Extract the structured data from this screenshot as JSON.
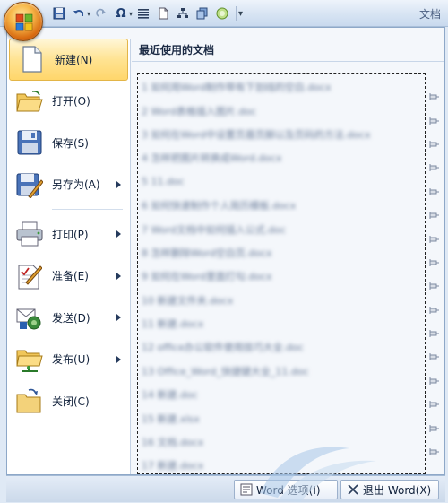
{
  "window": {
    "title": "文档"
  },
  "quick_access": {
    "icons": [
      "save-icon",
      "undo-icon",
      "redo-icon",
      "symbol-omega-icon",
      "align-icon",
      "new-doc-icon",
      "org-chart-icon",
      "copy-icon",
      "circle-icon",
      "customize-dropdown-icon"
    ],
    "omega": "Ω"
  },
  "menu": {
    "items": [
      {
        "label": "新建(N)",
        "icon": "new-document-icon",
        "has_submenu": false,
        "active": true
      },
      {
        "label": "打开(O)",
        "icon": "open-folder-icon",
        "has_submenu": false
      },
      {
        "label": "保存(S)",
        "icon": "save-disk-icon",
        "has_submenu": false
      },
      {
        "label": "另存为(A)",
        "icon": "save-as-icon",
        "has_submenu": true
      },
      {
        "label": "打印(P)",
        "icon": "printer-icon",
        "has_submenu": true
      },
      {
        "label": "准备(E)",
        "icon": "prepare-icon",
        "has_submenu": true
      },
      {
        "label": "发送(D)",
        "icon": "send-icon",
        "has_submenu": true
      },
      {
        "label": "发布(U)",
        "icon": "publish-icon",
        "has_submenu": true
      },
      {
        "label": "关闭(C)",
        "icon": "close-folder-icon",
        "has_submenu": false
      }
    ]
  },
  "recent": {
    "title": "最近使用的文档",
    "files": [
      "1 如何用Word制作带有下划线的空白.docx",
      "2 Word表格插入图片.doc",
      "3 如何在Word中设置页眉页脚以及页码的方法.docx",
      "4 怎样把图片转换成Word.docx",
      "5 11.doc",
      "6 如何快速制作个人简历模板.docx",
      "7 Word文档中如何插入公式.doc",
      "8 怎样删除Word空白页.docx",
      "9 如何在Word里面打勾.docx",
      "10 新建文件夹.docx",
      "11 新建.docx",
      "12 office办公软件使用技巧大全.doc",
      "13 Office_Word_快捷键大全_11.doc",
      "14 新建.doc",
      "15 新建.xlsx",
      "16 文档.docx",
      "17 新建.docx"
    ]
  },
  "bottom": {
    "word_options": "Word 选项(I)",
    "exit_word": "退出 Word(X)"
  },
  "colors": {
    "active_item": "#ffd66b",
    "panel_bg": "#f4f7fb",
    "ribbon_blue": "#c8d9ee"
  }
}
